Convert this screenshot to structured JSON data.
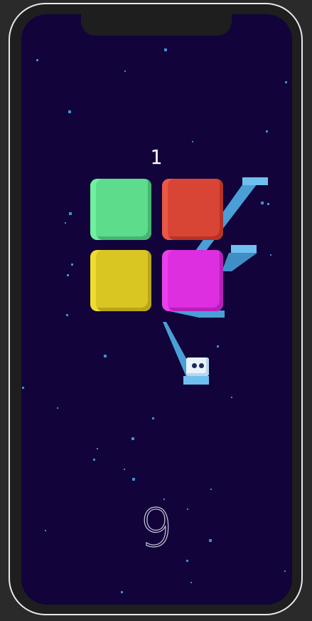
{
  "game": {
    "score": "1",
    "big_number": "9"
  },
  "colors": {
    "background": "#12033b",
    "tile_green": "#5ddc8b",
    "tile_red": "#d94535",
    "tile_yellow": "#d9c623",
    "tile_magenta": "#dd2ee0",
    "path_blue": "#4a9fd6",
    "star": "#3f8fd0"
  }
}
